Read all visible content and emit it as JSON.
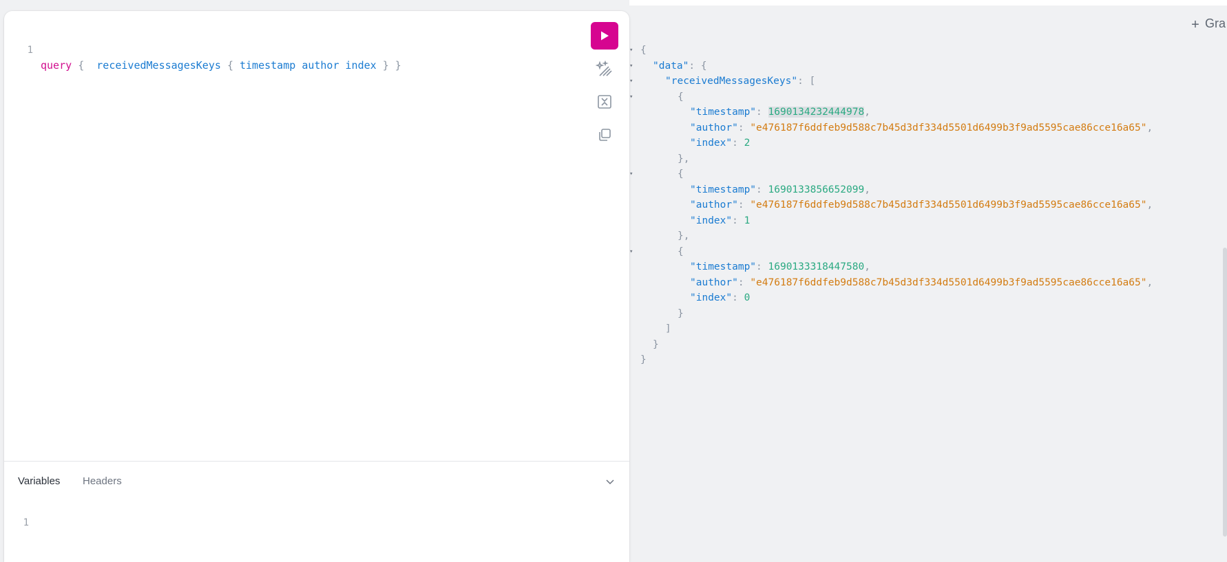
{
  "editor": {
    "line_number": "1",
    "query_keyword": "query",
    "brace_open": "{",
    "root_field": "receivedMessagesKeys",
    "inner_brace_open": "{",
    "fields": [
      "timestamp",
      "author",
      "index"
    ],
    "inner_brace_close": "}",
    "brace_close": "}"
  },
  "toolbar": {
    "run_icon": "play-icon",
    "prettify_icon": "magic-wand-icon",
    "merge_icon": "merge-fragments-icon",
    "copy_icon": "copy-icon"
  },
  "bottom_pane": {
    "tabs": [
      {
        "label": "Variables",
        "active": true
      },
      {
        "label": "Headers",
        "active": false
      }
    ],
    "variables_line_number": "1"
  },
  "result": {
    "tab_label": "Gra",
    "add_tab_label": "+",
    "lines": [
      {
        "tokens": [
          {
            "t": "p",
            "v": "{"
          }
        ],
        "fold": true
      },
      {
        "tokens": [
          {
            "t": "k",
            "v": "\"data\""
          },
          {
            "t": "p",
            "v": ": {"
          }
        ],
        "fold": true
      },
      {
        "tokens": [
          {
            "t": "k",
            "v": "\"receivedMessagesKeys\""
          },
          {
            "t": "p",
            "v": ": ["
          }
        ],
        "fold": true
      },
      {
        "tokens": [
          {
            "t": "p",
            "v": "{"
          }
        ],
        "fold": true
      },
      {
        "tokens": [
          {
            "t": "k",
            "v": "\"timestamp\""
          },
          {
            "t": "p",
            "v": ": "
          },
          {
            "t": "n",
            "v": "1690134232444978",
            "hl": true
          },
          {
            "t": "p",
            "v": ","
          }
        ]
      },
      {
        "tokens": [
          {
            "t": "k",
            "v": "\"author\""
          },
          {
            "t": "p",
            "v": ": "
          },
          {
            "t": "s",
            "v": "\"e476187f6ddfeb9d588c7b45d3df334d5501d6499b3f9ad5595cae86cce16a65\""
          },
          {
            "t": "p",
            "v": ","
          }
        ]
      },
      {
        "tokens": [
          {
            "t": "k",
            "v": "\"index\""
          },
          {
            "t": "p",
            "v": ": "
          },
          {
            "t": "n",
            "v": "2"
          }
        ]
      },
      {
        "tokens": [
          {
            "t": "p",
            "v": "},"
          }
        ]
      },
      {
        "tokens": [
          {
            "t": "p",
            "v": "{"
          }
        ],
        "fold": true
      },
      {
        "tokens": [
          {
            "t": "k",
            "v": "\"timestamp\""
          },
          {
            "t": "p",
            "v": ": "
          },
          {
            "t": "n",
            "v": "1690133856652099"
          },
          {
            "t": "p",
            "v": ","
          }
        ]
      },
      {
        "tokens": [
          {
            "t": "k",
            "v": "\"author\""
          },
          {
            "t": "p",
            "v": ": "
          },
          {
            "t": "s",
            "v": "\"e476187f6ddfeb9d588c7b45d3df334d5501d6499b3f9ad5595cae86cce16a65\""
          },
          {
            "t": "p",
            "v": ","
          }
        ]
      },
      {
        "tokens": [
          {
            "t": "k",
            "v": "\"index\""
          },
          {
            "t": "p",
            "v": ": "
          },
          {
            "t": "n",
            "v": "1"
          }
        ]
      },
      {
        "tokens": [
          {
            "t": "p",
            "v": "},"
          }
        ]
      },
      {
        "tokens": [
          {
            "t": "p",
            "v": "{"
          }
        ],
        "fold": true
      },
      {
        "tokens": [
          {
            "t": "k",
            "v": "\"timestamp\""
          },
          {
            "t": "p",
            "v": ": "
          },
          {
            "t": "n",
            "v": "1690133318447580"
          },
          {
            "t": "p",
            "v": ","
          }
        ]
      },
      {
        "tokens": [
          {
            "t": "k",
            "v": "\"author\""
          },
          {
            "t": "p",
            "v": ": "
          },
          {
            "t": "s",
            "v": "\"e476187f6ddfeb9d588c7b45d3df334d5501d6499b3f9ad5595cae86cce16a65\""
          },
          {
            "t": "p",
            "v": ","
          }
        ]
      },
      {
        "tokens": [
          {
            "t": "k",
            "v": "\"index\""
          },
          {
            "t": "p",
            "v": ": "
          },
          {
            "t": "n",
            "v": "0"
          }
        ]
      },
      {
        "tokens": [
          {
            "t": "p",
            "v": "}"
          }
        ]
      },
      {
        "tokens": [
          {
            "t": "p",
            "v": "]"
          }
        ]
      },
      {
        "tokens": [
          {
            "t": "p",
            "v": "}"
          }
        ]
      },
      {
        "tokens": [
          {
            "t": "p",
            "v": "}"
          }
        ]
      }
    ]
  },
  "colors": {
    "accent": "#d60590",
    "keyword": "#d10e8e",
    "field": "#1a7bd1",
    "number": "#2aa981",
    "string": "#d37c12"
  }
}
